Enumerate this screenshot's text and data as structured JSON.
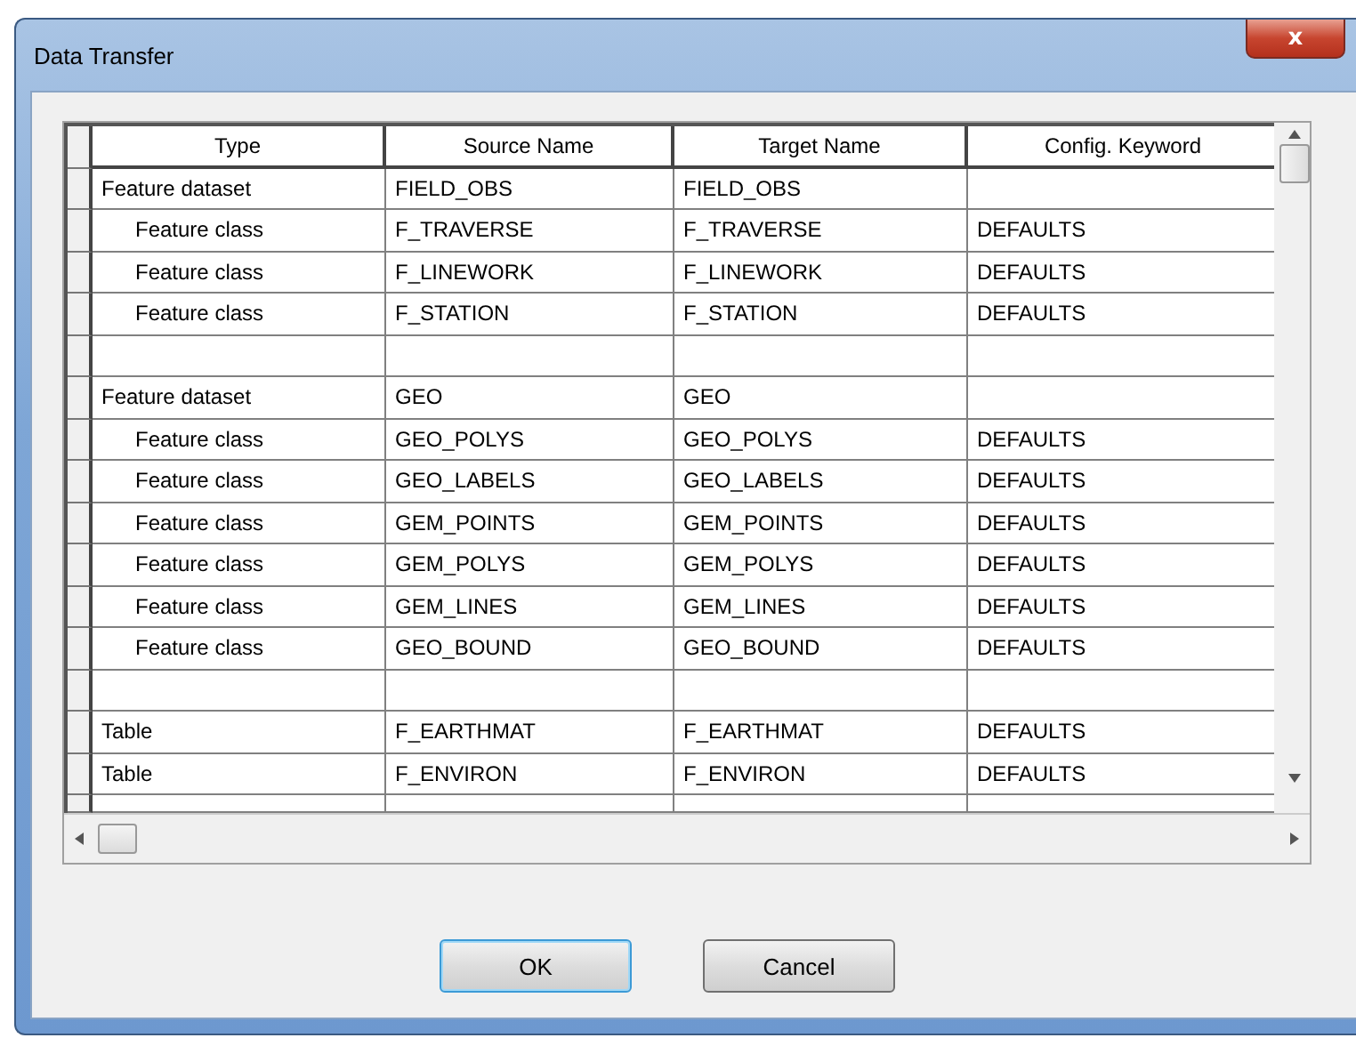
{
  "window": {
    "title": "Data Transfer",
    "close_label": "x"
  },
  "table": {
    "columns": [
      "Type",
      "Source Name",
      "Target Name",
      "Config. Keyword"
    ],
    "rows": [
      {
        "kind": "dataset",
        "cells": [
          "Feature dataset",
          "FIELD_OBS",
          "FIELD_OBS",
          ""
        ]
      },
      {
        "kind": "child",
        "cells": [
          "Feature class",
          "F_TRAVERSE",
          "F_TRAVERSE",
          "DEFAULTS"
        ]
      },
      {
        "kind": "child",
        "cells": [
          "Feature class",
          "F_LINEWORK",
          "F_LINEWORK",
          "DEFAULTS"
        ]
      },
      {
        "kind": "child",
        "cells": [
          "Feature class",
          "F_STATION",
          "F_STATION",
          "DEFAULTS"
        ]
      },
      {
        "kind": "blank",
        "cells": [
          "",
          "",
          "",
          ""
        ]
      },
      {
        "kind": "dataset",
        "cells": [
          "Feature dataset",
          "GEO",
          "GEO",
          ""
        ]
      },
      {
        "kind": "child",
        "cells": [
          "Feature class",
          "GEO_POLYS",
          "GEO_POLYS",
          "DEFAULTS"
        ]
      },
      {
        "kind": "child",
        "cells": [
          "Feature class",
          "GEO_LABELS",
          "GEO_LABELS",
          "DEFAULTS"
        ]
      },
      {
        "kind": "child",
        "cells": [
          "Feature class",
          "GEM_POINTS",
          "GEM_POINTS",
          "DEFAULTS"
        ]
      },
      {
        "kind": "child",
        "cells": [
          "Feature class",
          "GEM_POLYS",
          "GEM_POLYS",
          "DEFAULTS"
        ]
      },
      {
        "kind": "child",
        "cells": [
          "Feature class",
          "GEM_LINES",
          "GEM_LINES",
          "DEFAULTS"
        ]
      },
      {
        "kind": "child",
        "cells": [
          "Feature class",
          "GEO_BOUND",
          "GEO_BOUND",
          "DEFAULTS"
        ]
      },
      {
        "kind": "blank",
        "cells": [
          "",
          "",
          "",
          ""
        ]
      },
      {
        "kind": "dataset",
        "cells": [
          "Table",
          "F_EARTHMAT",
          "F_EARTHMAT",
          "DEFAULTS"
        ]
      },
      {
        "kind": "dataset",
        "cells": [
          "Table",
          "F_ENVIRON",
          "F_ENVIRON",
          "DEFAULTS"
        ]
      },
      {
        "kind": "cut",
        "cells": [
          "",
          "",
          "",
          ""
        ]
      }
    ]
  },
  "buttons": [
    {
      "label": "OK",
      "default": true
    },
    {
      "label": "Cancel",
      "default": false
    }
  ]
}
